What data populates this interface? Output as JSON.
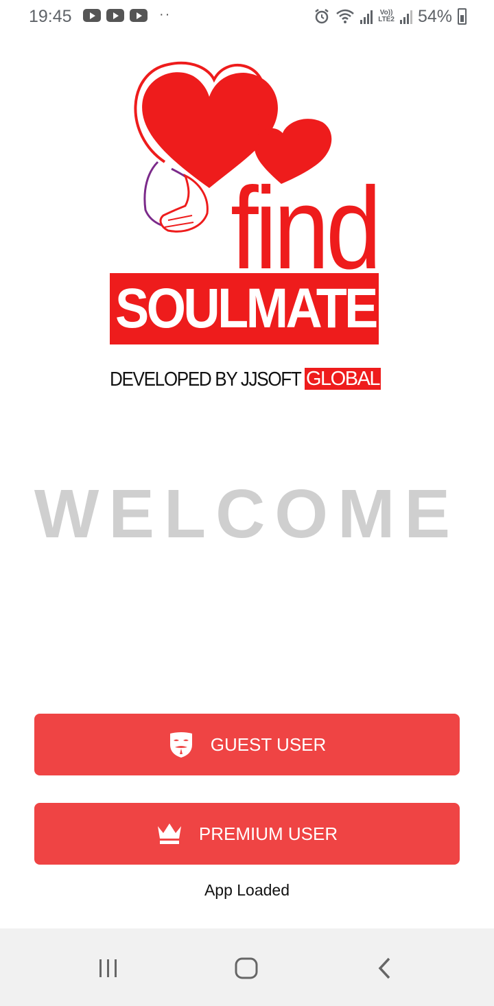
{
  "status_bar": {
    "time": "19:45",
    "notification_icons": [
      "youtube-icon",
      "youtube-icon",
      "youtube-icon"
    ],
    "more_dots": "··",
    "network_label_top": "Vo))",
    "network_label_bottom": "LTE2",
    "battery_percent": "54%"
  },
  "logo": {
    "find_text": "find",
    "brand_text": "SOULMATE",
    "developer_text": "DEVELOPED BY JJSOFT",
    "developer_highlight": "GLOBAL",
    "colors": {
      "brand_red": "#ee1c1c"
    }
  },
  "welcome": {
    "title": "WELCOME"
  },
  "buttons": {
    "guest": {
      "label": "GUEST USER",
      "icon": "mask-icon"
    },
    "premium": {
      "label": "PREMIUM USER",
      "icon": "crown-icon"
    },
    "color": "#ef4444"
  },
  "app_status": "App Loaded",
  "nav_bar": {
    "recents": "recents-icon",
    "home": "home-icon",
    "back": "back-icon"
  }
}
